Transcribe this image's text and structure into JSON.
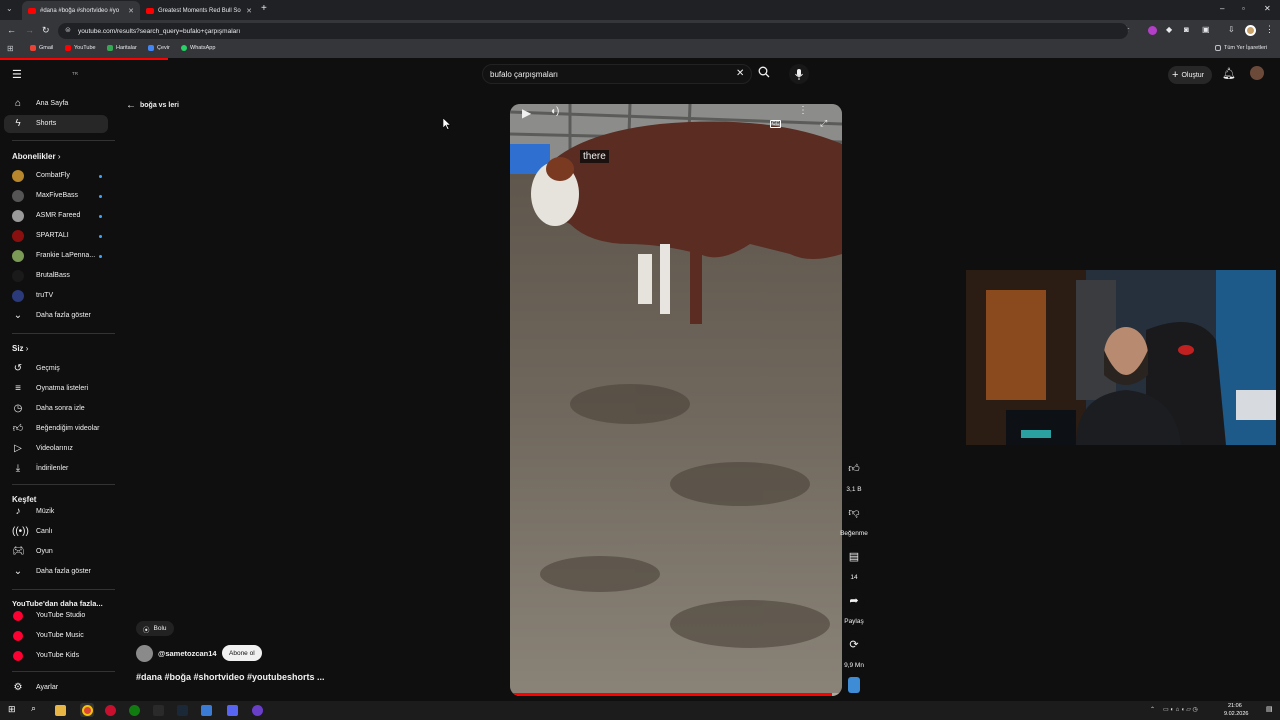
{
  "browser": {
    "tabs": [
      {
        "label": "#dana #boğa #shortvideo #yo"
      },
      {
        "label": "Greatest Moments Red Bull So"
      }
    ],
    "url": "youtube.com/results?search_query=bufalo+çarpışmaları",
    "bookmarks": [
      "Gmail",
      "YouTube",
      "Haritalar",
      "Çevir",
      "WhatsApp"
    ],
    "all_bookmarks": "Tüm Yer İşaretleri",
    "new_tab": "+"
  },
  "header": {
    "country": "TR",
    "search_value": "bufalo çarpışmaları",
    "create_label": "Oluştur"
  },
  "sidebar": {
    "main": [
      {
        "label": "Ana Sayfa",
        "icon": "home-icon"
      },
      {
        "label": "Shorts",
        "icon": "shorts-icon"
      }
    ],
    "subs_title": "Abonelikler",
    "subs": [
      {
        "label": "CombatFly",
        "color": "#b8862d"
      },
      {
        "label": "MaxFiveBass",
        "color": "#555555"
      },
      {
        "label": "ASMR Fareed",
        "color": "#9a9a9a"
      },
      {
        "label": "SPARTALI",
        "color": "#8a1010"
      },
      {
        "label": "Frankie LaPenna...",
        "color": "#7a9a55"
      },
      {
        "label": "BrutalBass",
        "color": "#1a1a1a"
      },
      {
        "label": "truTV",
        "color": "#2b3a7a"
      }
    ],
    "show_more": "Daha fazla göster",
    "you_title": "Siz",
    "you": [
      {
        "label": "Geçmiş",
        "icon": "history-icon"
      },
      {
        "label": "Oynatma listeleri",
        "icon": "playlists-icon"
      },
      {
        "label": "Daha sonra izle",
        "icon": "watch-later-icon"
      },
      {
        "label": "Beğendiğim videolar",
        "icon": "liked-icon"
      },
      {
        "label": "Videolarınız",
        "icon": "your-videos-icon"
      },
      {
        "label": "İndirilenler",
        "icon": "downloads-icon"
      }
    ],
    "explore_title": "Keşfet",
    "explore": [
      {
        "label": "Müzik",
        "icon": "music-icon"
      },
      {
        "label": "Canlı",
        "icon": "live-icon"
      },
      {
        "label": "Oyun",
        "icon": "gaming-icon"
      }
    ],
    "explore_more": "Daha fazla göster",
    "more_title": "YouTube'dan daha fazla...",
    "more": [
      {
        "label": "YouTube Studio"
      },
      {
        "label": "YouTube Music"
      },
      {
        "label": "YouTube Kids"
      }
    ],
    "settings": "Ayarlar"
  },
  "shorts": {
    "back_label": "boğa vs leri",
    "location": "Bolu",
    "channel": "@sametozcan14",
    "subscribe": "Abone ol",
    "caption_title": "#dana #boğa #shortvideo #youtubeshorts ...",
    "subtitle": "there",
    "cc": "CC",
    "likes": "3,1 B",
    "dislike": "Beğenme",
    "comments": "14",
    "share": "Paylaş",
    "remix": "9,9 Mn",
    "progress": 0.97
  },
  "taskbar": {
    "time": "21:06",
    "date": "9.02.2026"
  }
}
